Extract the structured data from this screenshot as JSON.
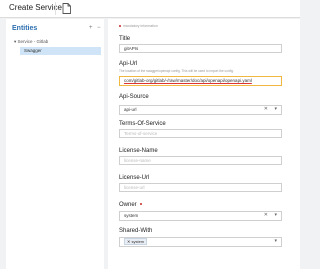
{
  "header": {
    "title": "Create Service",
    "doc_icon": "document-icon"
  },
  "left": {
    "heading": "Entities",
    "controls": {
      "add": "+",
      "collapse": "−"
    },
    "tree": {
      "parent": "Service - Gitlab",
      "child": "Swagger"
    }
  },
  "form": {
    "required_note": "mandatory information",
    "title": {
      "label": "Title",
      "value": "gitAPIs"
    },
    "api_url": {
      "label": "Api-Url",
      "help": "The location of the swagger/openapi config. This will be used to import the config.",
      "value": "com/gitlab-org/gitlab/-/raw/master/doc/api/openapi/openapi.yaml"
    },
    "api_source": {
      "label": "Api-Source",
      "value": "api-url"
    },
    "terms": {
      "label": "Terms-Of-Service",
      "placeholder": "Terms-of-service"
    },
    "license_name": {
      "label": "License-Name",
      "placeholder": "license-name"
    },
    "license_url": {
      "label": "License-Url",
      "placeholder": "license-url"
    },
    "owner": {
      "label": "Owner",
      "value": "system"
    },
    "shared_with": {
      "label": "Shared-With",
      "tag": "system"
    }
  }
}
